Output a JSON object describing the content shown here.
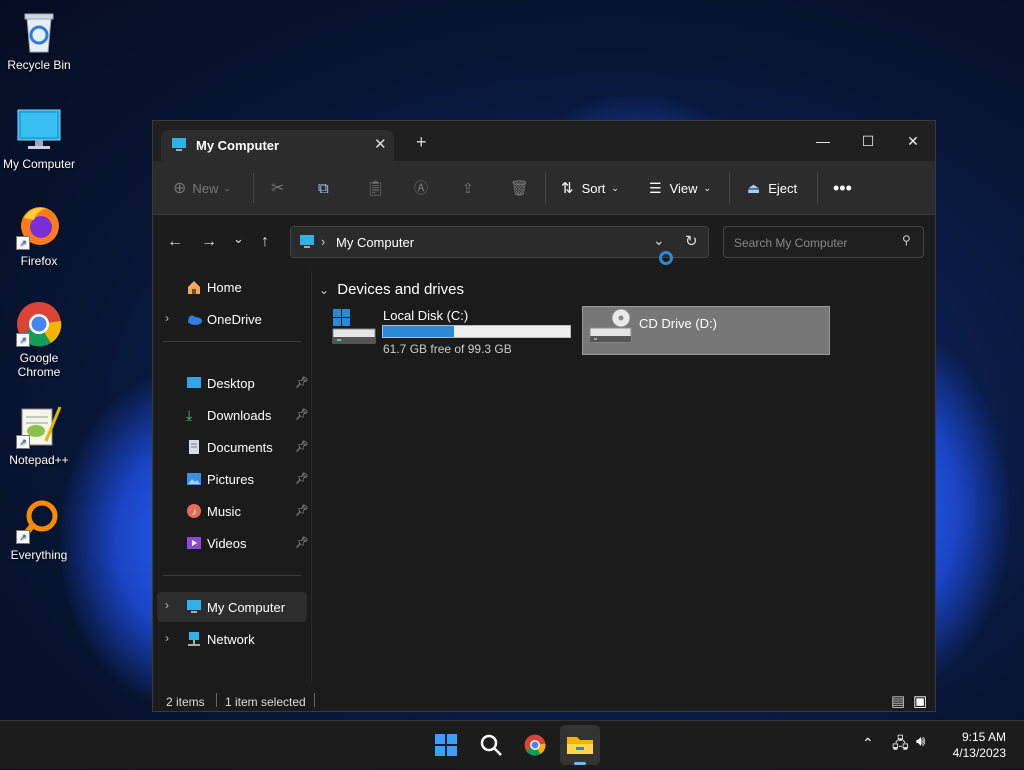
{
  "desktop": {
    "icons": [
      {
        "label": "Recycle Bin",
        "icon": "recycle-bin-icon"
      },
      {
        "label": "My Computer",
        "icon": "computer-icon"
      },
      {
        "label": "Firefox",
        "icon": "firefox-icon"
      },
      {
        "label": "Google Chrome",
        "icon": "chrome-icon"
      },
      {
        "label": "Notepad++",
        "icon": "notepad-plus-plus-icon"
      },
      {
        "label": "Everything",
        "icon": "everything-search-icon"
      }
    ]
  },
  "window": {
    "tab_title": "My Computer",
    "toolbar": {
      "new_label": "New",
      "sort_label": "Sort",
      "view_label": "View",
      "eject_label": "Eject"
    },
    "address": {
      "path": "My Computer"
    },
    "search": {
      "placeholder": "Search My Computer"
    },
    "sidebar": {
      "top": [
        {
          "label": "Home",
          "icon": "home-icon"
        },
        {
          "label": "OneDrive",
          "icon": "onedrive-cloud-icon"
        }
      ],
      "pinned": [
        {
          "label": "Desktop",
          "icon": "desktop-folder-icon"
        },
        {
          "label": "Downloads",
          "icon": "download-icon"
        },
        {
          "label": "Documents",
          "icon": "documents-icon"
        },
        {
          "label": "Pictures",
          "icon": "pictures-icon"
        },
        {
          "label": "Music",
          "icon": "music-icon"
        },
        {
          "label": "Videos",
          "icon": "videos-icon"
        }
      ],
      "bottom": [
        {
          "label": "My Computer",
          "icon": "computer-icon",
          "selected": true
        },
        {
          "label": "Network",
          "icon": "network-icon"
        }
      ]
    },
    "content": {
      "group_header": "Devices and drives",
      "drives": [
        {
          "name": "Local Disk (C:)",
          "free_text": "61.7 GB free of 99.3 GB",
          "used_fraction": 0.379,
          "icon": "hard-drive-icon"
        },
        {
          "name": "CD Drive (D:)",
          "icon": "cd-drive-icon",
          "selected": true
        }
      ]
    },
    "status": {
      "items": "2 items",
      "selected": "1 item selected"
    }
  },
  "taskbar": {
    "time": "9:15 AM",
    "date": "4/13/2023"
  },
  "colors": {
    "accent": "#2a8ad8",
    "window_bg": "#1b1b1b",
    "toolbar_bg": "#2c2c2c",
    "selection_bg": "#777777"
  }
}
